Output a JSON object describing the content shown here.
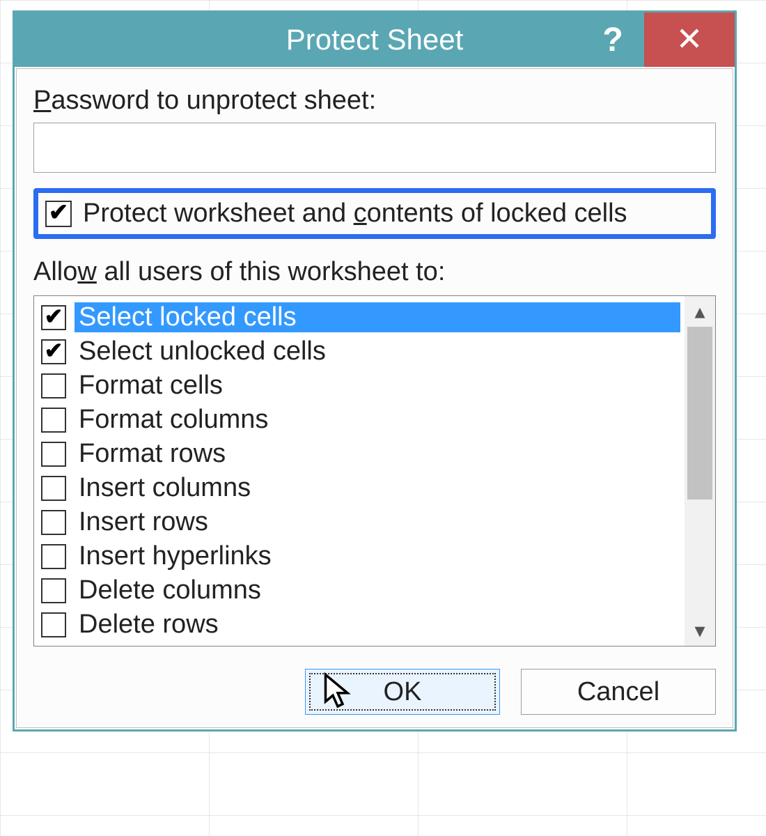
{
  "dialog": {
    "title": "Protect Sheet",
    "password_label_pre": "P",
    "password_label_rest": "assword to unprotect sheet:",
    "password_value": "",
    "protect_checkbox": {
      "checked": true,
      "label_pre": "Protect worksheet and ",
      "label_u": "c",
      "label_post": "ontents of locked cells"
    },
    "allow_label_pre": "Allo",
    "allow_label_u": "w",
    "allow_label_post": " all users of this worksheet to:",
    "permissions": [
      {
        "label": "Select locked cells",
        "checked": true,
        "selected": true
      },
      {
        "label": "Select unlocked cells",
        "checked": true,
        "selected": false
      },
      {
        "label": "Format cells",
        "checked": false,
        "selected": false
      },
      {
        "label": "Format columns",
        "checked": false,
        "selected": false
      },
      {
        "label": "Format rows",
        "checked": false,
        "selected": false
      },
      {
        "label": "Insert columns",
        "checked": false,
        "selected": false
      },
      {
        "label": "Insert rows",
        "checked": false,
        "selected": false
      },
      {
        "label": "Insert hyperlinks",
        "checked": false,
        "selected": false
      },
      {
        "label": "Delete columns",
        "checked": false,
        "selected": false
      },
      {
        "label": "Delete rows",
        "checked": false,
        "selected": false
      }
    ],
    "buttons": {
      "ok": "OK",
      "cancel": "Cancel"
    },
    "help_glyph": "?",
    "scroll_up_glyph": "▴",
    "scroll_down_glyph": "▾"
  }
}
